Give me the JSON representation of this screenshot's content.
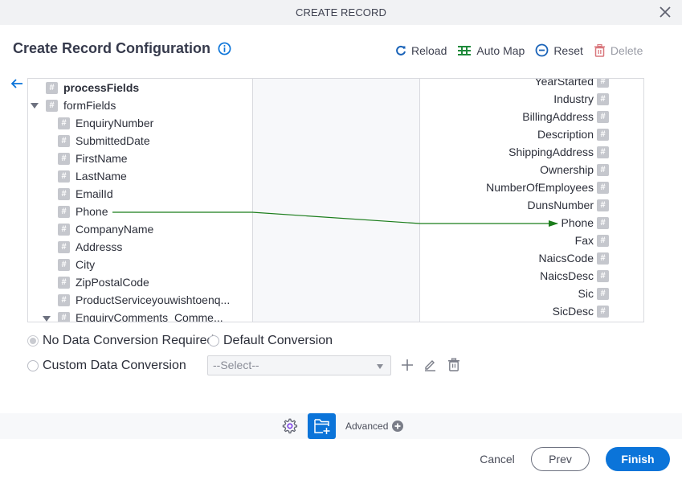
{
  "dialog": {
    "title": "CREATE RECORD",
    "close_icon": "close-icon"
  },
  "header": {
    "title": "Create Record Configuration",
    "info_icon": "info-icon"
  },
  "toolbar": {
    "reload": "Reload",
    "auto_map": "Auto Map",
    "reset": "Reset",
    "delete": "Delete"
  },
  "colors": {
    "accent": "#0b74d9",
    "auto_map_green": "#1f8a3b",
    "delete_red": "#d9777c",
    "connector": "#1b7d1b"
  },
  "source_tree": {
    "items": [
      {
        "label": "processFields",
        "level": 0,
        "bold": true,
        "expanded": null
      },
      {
        "label": "formFields",
        "level": 0,
        "bold": false,
        "expanded": true
      },
      {
        "label": "EnquiryNumber",
        "level": 1
      },
      {
        "label": "SubmittedDate",
        "level": 1
      },
      {
        "label": "FirstName",
        "level": 1
      },
      {
        "label": "LastName",
        "level": 1
      },
      {
        "label": "EmailId",
        "level": 1
      },
      {
        "label": "Phone",
        "level": 1
      },
      {
        "label": "CompanyName",
        "level": 1
      },
      {
        "label": "Addresss",
        "level": 1
      },
      {
        "label": "City",
        "level": 1
      },
      {
        "label": "ZipPostalCode",
        "level": 1
      },
      {
        "label": "ProductServiceyouwishtoenq...",
        "level": 1
      },
      {
        "label": "EnquiryComments_Comme...",
        "level": 1,
        "expanded": true
      }
    ]
  },
  "target_list": {
    "items": [
      "YearStarted",
      "Industry",
      "BillingAddress",
      "Description",
      "ShippingAddress",
      "Ownership",
      "NumberOfEmployees",
      "DunsNumber",
      "Phone",
      "Fax",
      "NaicsCode",
      "NaicsDesc",
      "Sic",
      "SicDesc"
    ]
  },
  "mappings": [
    {
      "source": "Phone",
      "target": "Phone"
    }
  ],
  "conversion": {
    "no_conversion": "No Data Conversion Required",
    "default_conversion": "Default Conversion",
    "custom_conversion": "Custom Data Conversion",
    "selected": "no_conversion",
    "select_placeholder": "--Select--"
  },
  "bottom_bar": {
    "advanced": "Advanced"
  },
  "footer": {
    "cancel": "Cancel",
    "prev": "Prev",
    "finish": "Finish"
  }
}
